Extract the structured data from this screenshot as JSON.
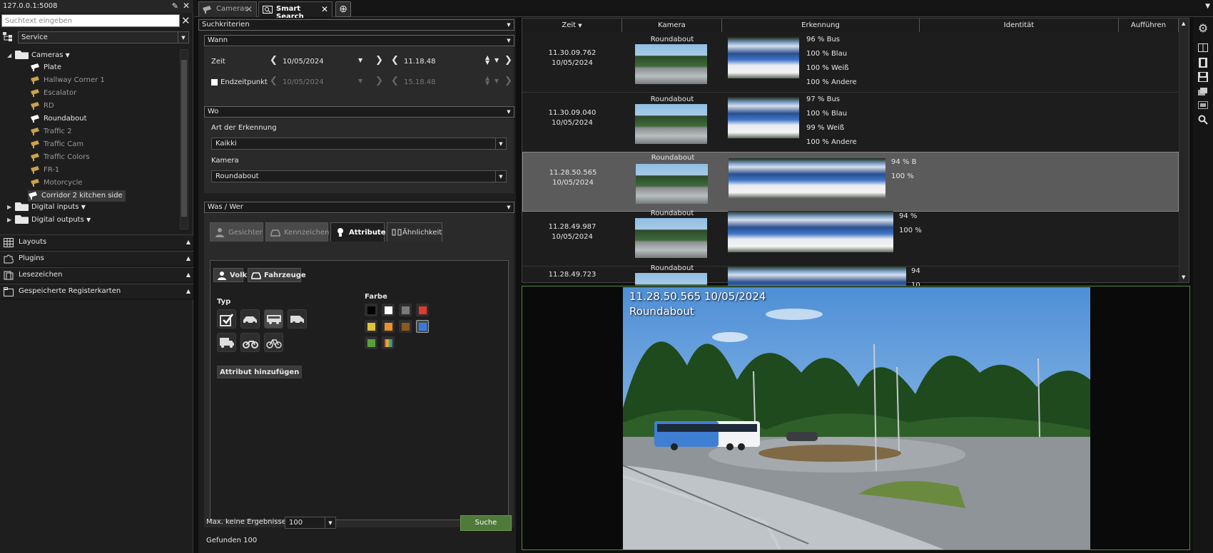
{
  "server": {
    "address": "127.0.0.1:5008"
  },
  "left": {
    "search_placeholder": "Suchtext eingeben",
    "dropdown": "Service",
    "tree": {
      "cameras_label": "Cameras",
      "items": [
        "Plate",
        "Hallway Corner 1",
        "Escalator",
        "RD",
        "Roundabout",
        "Traffic 2",
        "Traffic Cam",
        "Traffic Colors",
        "FR-1",
        "Motorcycle",
        "Corridor 2 kitchen side"
      ],
      "digital_inputs": "Digital inputs",
      "digital_outputs": "Digital outputs"
    },
    "sections": [
      "Layouts",
      "Plugins",
      "Lesezeichen",
      "Gespeicherte Registerkarten"
    ]
  },
  "tabs": {
    "cameras": "Cameras",
    "smart_search": "Smart Search"
  },
  "criteria": {
    "header": "Suchkriterien",
    "wann": {
      "title": "Wann",
      "zeit_label": "Zeit",
      "start_date": "10/05/2024",
      "start_time": "11.18.48",
      "endzeit_label": "Endzeitpunkt",
      "end_date": "10/05/2024",
      "end_time": "15.18.48"
    },
    "wo": {
      "title": "Wo",
      "art_label": "Art der Erkennung",
      "art_value": "Kaikki",
      "kamera_label": "Kamera",
      "kamera_value": "Roundabout"
    },
    "waswer": {
      "title": "Was / Wer",
      "tabs": [
        "Gesichter",
        "Kennzeichen",
        "Attribute",
        "Ähnlichkeit"
      ],
      "volk": "Volk",
      "fahrzeuge": "Fahrzeuge",
      "typ_label": "Typ",
      "farbe_label": "Farbe",
      "colors": [
        "#000000",
        "#ffffff",
        "#7a7a7a",
        "#e03a2e",
        "#e0c23a",
        "#e8902a",
        "#8a5a1e",
        "#3a7ae0",
        "#5aa03a",
        "multi"
      ],
      "add_attr": "Attribut hinzufügen"
    },
    "max_label": "Max. keine Ergebnisse",
    "max_value": "100",
    "search_btn": "Suche",
    "found": "Gefunden 100"
  },
  "results": {
    "columns": [
      "Zeit",
      "Kamera",
      "Erkennung",
      "Identität",
      "Aufführen"
    ],
    "rows": [
      {
        "time": "11.30.09.762",
        "date": "10/05/2024",
        "camera": "Roundabout",
        "dets": [
          "96 %  Bus",
          "100 %  Blau",
          "100 %  Weiß",
          "100 %  Andere"
        ]
      },
      {
        "time": "11.30.09.040",
        "date": "10/05/2024",
        "camera": "Roundabout",
        "dets": [
          "97 %  Bus",
          "100 %  Blau",
          "99 %  Weiß",
          "100 %  Andere"
        ]
      },
      {
        "time": "11.28.50.565",
        "date": "10/05/2024",
        "camera": "Roundabout",
        "dets": [
          "94 %  B",
          "100 %"
        ]
      },
      {
        "time": "11.28.49.987",
        "date": "10/05/2024",
        "camera": "Roundabout",
        "dets": [
          "94 %",
          "100 %"
        ]
      },
      {
        "time": "11.28.49.723",
        "date": "",
        "camera": "Roundabout",
        "dets": [
          "94",
          "10"
        ]
      }
    ]
  },
  "video": {
    "timestamp": "11.28.50.565  10/05/2024",
    "camera": "Roundabout"
  }
}
